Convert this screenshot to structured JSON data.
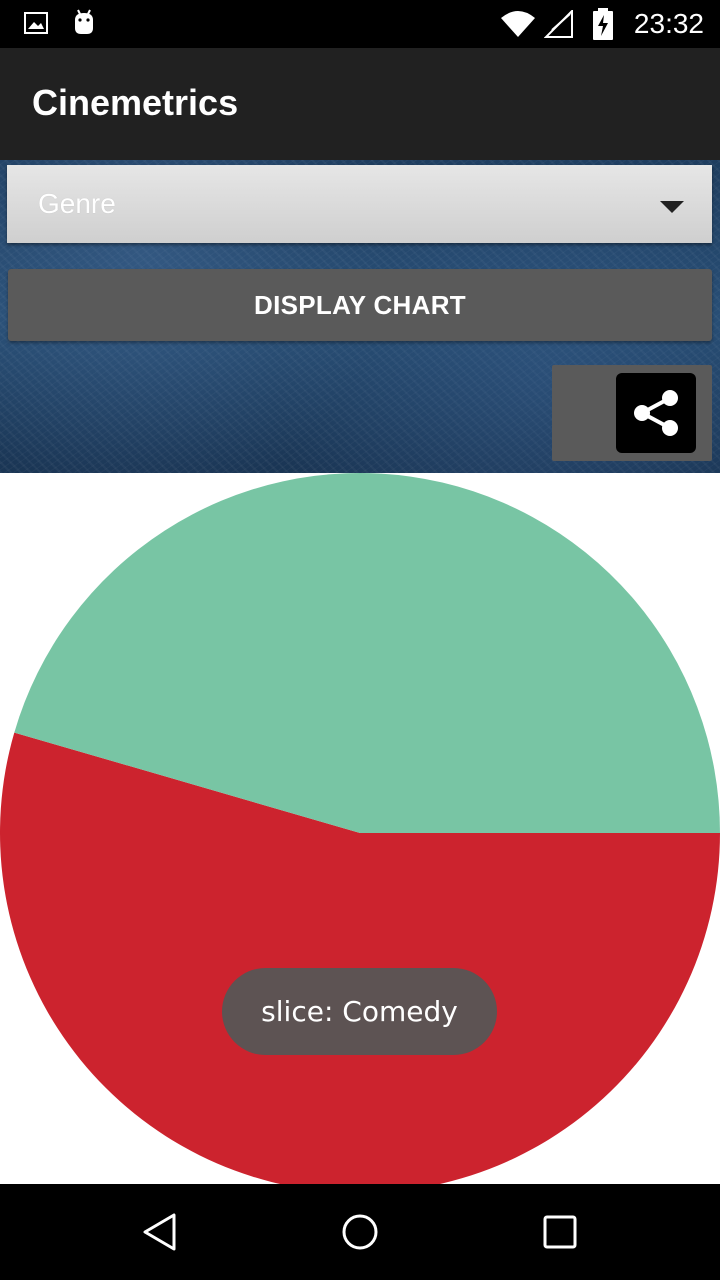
{
  "status_bar": {
    "time": "23:32",
    "icons": [
      "image-notification-icon",
      "android-notification-icon",
      "wifi-icon",
      "signal-icon",
      "battery-charging-icon"
    ]
  },
  "app_bar": {
    "title": "Cinemetrics"
  },
  "controls": {
    "spinner_value": "Genre",
    "display_button_label": "DISPLAY CHART",
    "share_icon": "share-icon"
  },
  "chart_data": {
    "type": "pie",
    "slices": [
      {
        "label": "Comedy",
        "value": 0.545,
        "color": "#cc232e"
      },
      {
        "label": "",
        "value": 0.455,
        "color": "#78c5a4"
      }
    ],
    "title": "",
    "legend": "none"
  },
  "toast": {
    "text": "slice: Comedy"
  },
  "nav_bar": {
    "buttons": [
      "back-icon",
      "home-icon",
      "recents-icon"
    ]
  }
}
